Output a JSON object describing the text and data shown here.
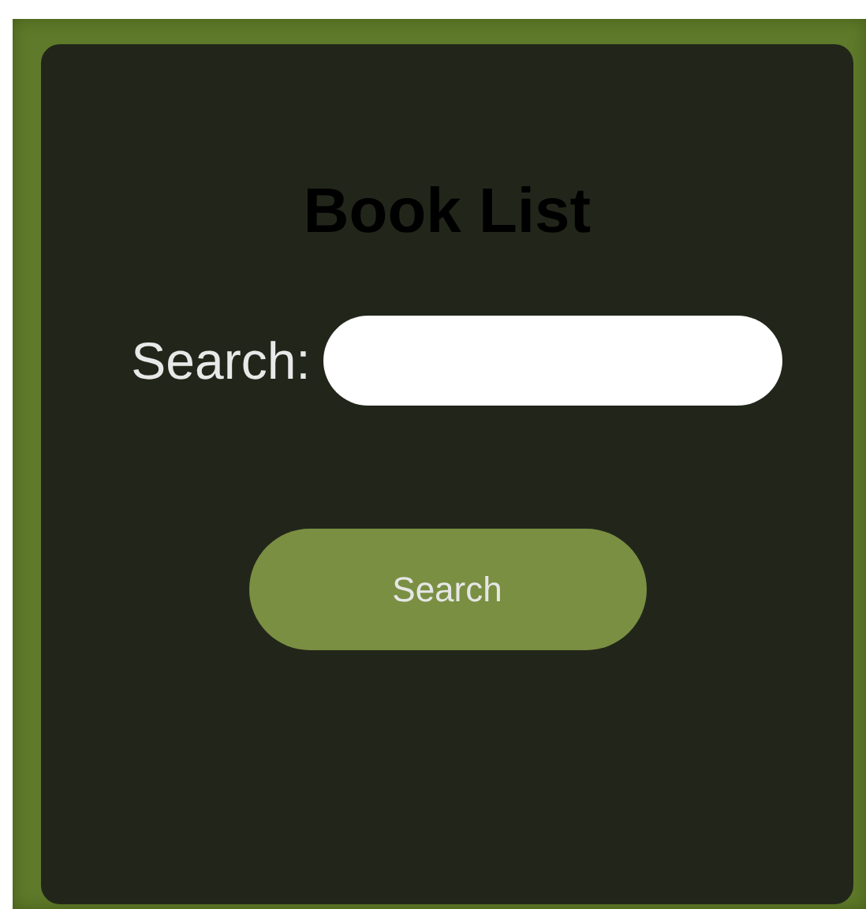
{
  "title": "Book List",
  "search": {
    "label": "Search:"
  },
  "button": {
    "label": "Search"
  }
}
